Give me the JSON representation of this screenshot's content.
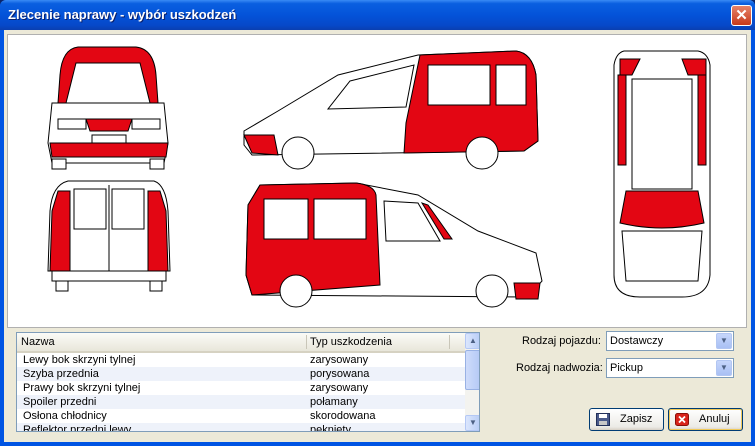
{
  "window": {
    "title": "Zlecenie naprawy - wybór uszkodzeń",
    "close_glyph": "✕"
  },
  "damage_list": {
    "columns": [
      "Nazwa",
      "Typ uszkodzenia"
    ],
    "rows": [
      {
        "name": "Lewy bok skrzyni tylnej",
        "type": "zarysowany"
      },
      {
        "name": "Szyba przednia",
        "type": "porysowana"
      },
      {
        "name": "Prawy bok skrzyni tylnej",
        "type": "zarysowany"
      },
      {
        "name": "Spoiler przedni",
        "type": "połamany"
      },
      {
        "name": "Osłona chłodnicy",
        "type": "skorodowana"
      },
      {
        "name": "Reflektor przedni lewy",
        "type": "pęknięty"
      }
    ]
  },
  "vehicle_type": {
    "label": "Rodzaj pojazdu:",
    "value": "Dostawczy"
  },
  "body_type": {
    "label": "Rodzaj nadwozia:",
    "value": "Pickup"
  },
  "buttons": {
    "save": "Zapisz",
    "cancel": "Anuluj"
  },
  "colors": {
    "damage": "#e30613",
    "titlebar": "#0453d9",
    "dialog": "#ece9d8"
  }
}
